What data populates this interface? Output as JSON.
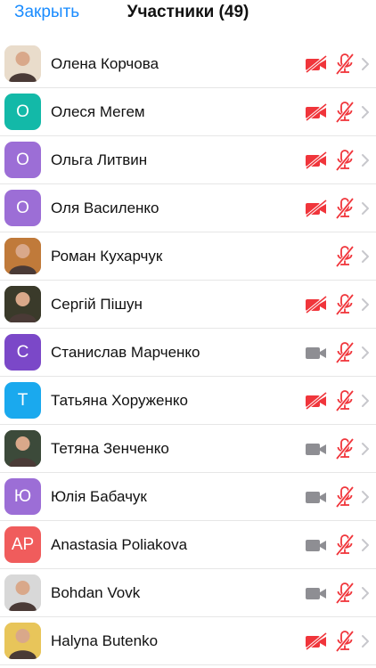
{
  "header": {
    "close_label": "Закрыть",
    "title": "Участники (49)"
  },
  "colors": {
    "accent": "#1a8cff",
    "muted_red": "#f0353b",
    "cam_gray": "#8e8e93",
    "chevron": "#c7c7cc"
  },
  "participants": [
    {
      "name": "Олена Корчова",
      "avatar_letter": "",
      "avatar_color": "#e9dccb",
      "photo": true,
      "cam_muted": true,
      "mic_muted": true
    },
    {
      "name": "Олеся Мегем",
      "avatar_letter": "О",
      "avatar_color": "#13b9a8",
      "photo": false,
      "cam_muted": true,
      "mic_muted": true
    },
    {
      "name": "Ольга Литвин",
      "avatar_letter": "О",
      "avatar_color": "#9c6ed6",
      "photo": false,
      "cam_muted": true,
      "mic_muted": true
    },
    {
      "name": "Оля Василенко",
      "avatar_letter": "О",
      "avatar_color": "#9c6ed6",
      "photo": false,
      "cam_muted": true,
      "mic_muted": true
    },
    {
      "name": "Роман Кухарчук",
      "avatar_letter": "",
      "avatar_color": "#c07a3a",
      "photo": true,
      "cam_muted": null,
      "mic_muted": true
    },
    {
      "name": "Сергій Пішун",
      "avatar_letter": "",
      "avatar_color": "#3a3a2a",
      "photo": true,
      "cam_muted": true,
      "mic_muted": true
    },
    {
      "name": "Станислав Марченко",
      "avatar_letter": "С",
      "avatar_color": "#7b48c8",
      "photo": false,
      "cam_muted": false,
      "mic_muted": true
    },
    {
      "name": "Татьяна Хоруженко",
      "avatar_letter": "Т",
      "avatar_color": "#1aa9ee",
      "photo": false,
      "cam_muted": true,
      "mic_muted": true
    },
    {
      "name": "Тетяна Зенченко",
      "avatar_letter": "",
      "avatar_color": "#3c4a3a",
      "photo": true,
      "cam_muted": false,
      "mic_muted": true
    },
    {
      "name": "Юлія Бабачук",
      "avatar_letter": "Ю",
      "avatar_color": "#9c6ed6",
      "photo": false,
      "cam_muted": false,
      "mic_muted": true
    },
    {
      "name": "Anastasia Poliakova",
      "avatar_letter": "AP",
      "avatar_color": "#f05c5c",
      "photo": false,
      "cam_muted": false,
      "mic_muted": true
    },
    {
      "name": "Bohdan Vovk",
      "avatar_letter": "",
      "avatar_color": "#d8d8d8",
      "photo": true,
      "cam_muted": false,
      "mic_muted": true
    },
    {
      "name": "Halyna Butenko",
      "avatar_letter": "",
      "avatar_color": "#e8c55a",
      "photo": true,
      "cam_muted": true,
      "mic_muted": true
    }
  ]
}
